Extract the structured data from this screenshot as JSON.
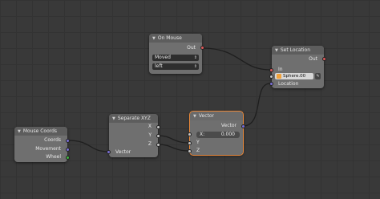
{
  "nodes": {
    "on_mouse": {
      "title": "On Mouse",
      "output_out": "Out",
      "event_value": "Moved",
      "button_value": "left"
    },
    "set_location": {
      "title": "Set Location",
      "output_out": "Out",
      "input_in": "In",
      "object_value": "Sphere.00",
      "input_location": "Location"
    },
    "mouse_coords": {
      "title": "Mouse Coords",
      "output_coords": "Coords",
      "output_movement": "Movement",
      "output_wheel": "Wheel"
    },
    "separate_xyz": {
      "title": "Separate XYZ",
      "output_x": "X",
      "output_y": "Y",
      "output_z": "Z",
      "input_vector": "Vector"
    },
    "vector": {
      "title": "Vector",
      "output_vector": "Vector",
      "x_label": "X:",
      "x_value": "0.000",
      "input_y": "Y",
      "input_z": "Z"
    }
  },
  "colors": {
    "background": "#393939",
    "node_body": "#6f6f6f",
    "socket_flow": "#e05a5a",
    "socket_vector": "#7a6fd6",
    "socket_value": "#c8c8c8",
    "socket_int": "#3fb53f",
    "active_outline": "#e8883a",
    "link": "#1e1e1e"
  }
}
